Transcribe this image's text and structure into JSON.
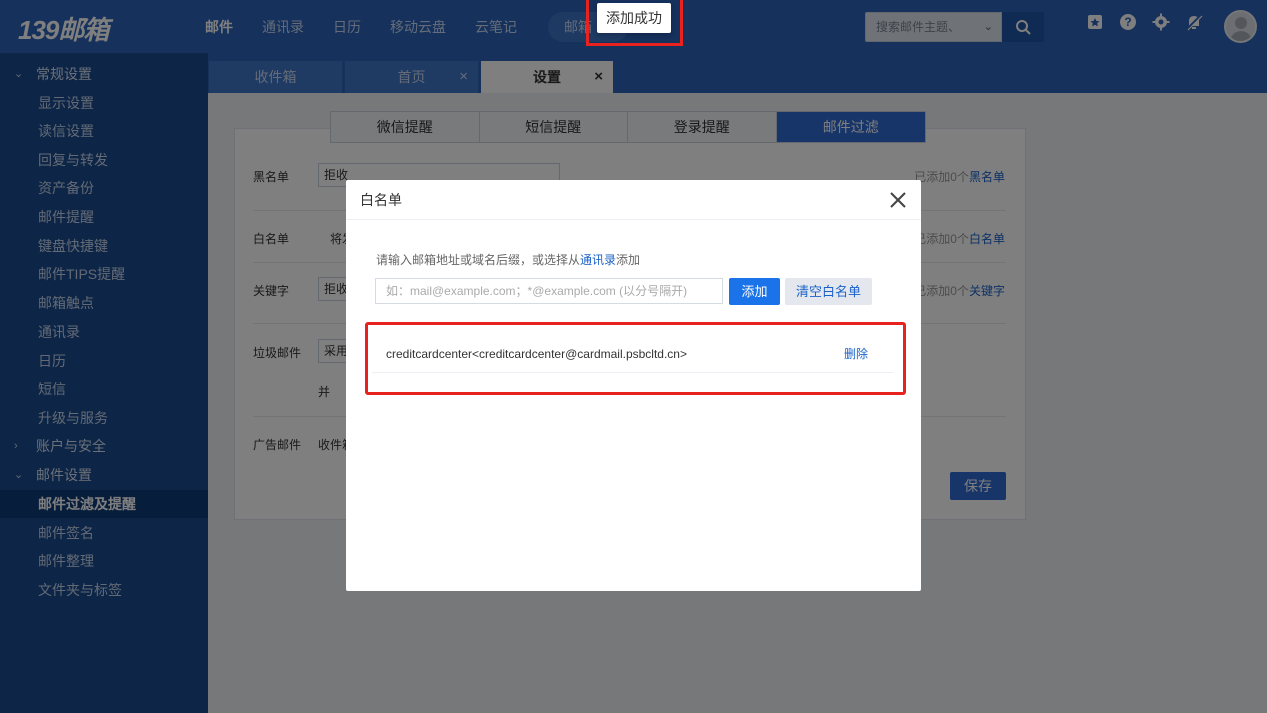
{
  "app": {
    "logo": "139邮箱"
  },
  "topnav": {
    "items": [
      "邮件",
      "通讯录",
      "日历",
      "移动云盘",
      "云笔记"
    ],
    "pill": "邮箱",
    "search_placeholder": "搜索邮件主题、",
    "icons": [
      "bookmark-icon",
      "help-icon",
      "gear-icon",
      "mute-bell-icon"
    ]
  },
  "toast": {
    "text": "添加成功"
  },
  "sidebar": {
    "items": [
      {
        "label": "常规设置",
        "type": "group",
        "expanded": true
      },
      {
        "label": "显示设置"
      },
      {
        "label": "读信设置"
      },
      {
        "label": "回复与转发"
      },
      {
        "label": "资产备份"
      },
      {
        "label": "邮件提醒"
      },
      {
        "label": "键盘快捷键"
      },
      {
        "label": "邮件TIPS提醒"
      },
      {
        "label": "邮箱触点"
      },
      {
        "label": "通讯录"
      },
      {
        "label": "日历"
      },
      {
        "label": "短信"
      },
      {
        "label": "升级与服务"
      },
      {
        "label": "账户与安全",
        "type": "group",
        "expanded": false
      },
      {
        "label": "邮件设置",
        "type": "group",
        "expanded": true
      },
      {
        "label": "邮件过滤及提醒",
        "active": true
      },
      {
        "label": "邮件签名"
      },
      {
        "label": "邮件整理"
      },
      {
        "label": "文件夹与标签"
      }
    ]
  },
  "tabs": [
    {
      "label": "收件箱"
    },
    {
      "label": "首页",
      "close": "×"
    },
    {
      "label": "设置",
      "close": "×",
      "active": true
    }
  ],
  "subtabs": [
    "微信提醒",
    "短信提醒",
    "登录提醒",
    "邮件过滤"
  ],
  "filter": {
    "blacklist_label": "黑名单",
    "blacklist_select": "拒收",
    "blacklist_right": "已添加0个",
    "blacklist_link": "黑名单",
    "whitelist_label": "白名单",
    "whitelist_text": "将发",
    "whitelist_right": "已添加0个",
    "whitelist_link": "白名单",
    "keyword_label": "关键字",
    "keyword_select": "拒收",
    "keyword_right": "已添加0个",
    "keyword_link": "关键字",
    "spam_label": "垃圾邮件",
    "spam_select": "采用",
    "spam_and": "并",
    "ad_label": "广告邮件",
    "ad_text": "收件箱",
    "save": "保存"
  },
  "modal": {
    "title": "白名单",
    "hint_prefix": "请输入邮箱地址或域名后缀，或选择从",
    "hint_link": "通讯录",
    "hint_suffix": "添加",
    "input_placeholder": "如：mail@example.com；*@example.com (以分号隔开)",
    "add_button": "添加",
    "clear_button": "清空白名单",
    "entries": [
      {
        "address": "creditcardcenter<creditcardcenter@cardmail.psbcltd.cn>",
        "delete": "删除"
      }
    ]
  },
  "colors": {
    "primary": "#2b63b8",
    "sidebar": "#1a4a8c",
    "highlight": "#e8231f",
    "button": "#1a73e8"
  }
}
